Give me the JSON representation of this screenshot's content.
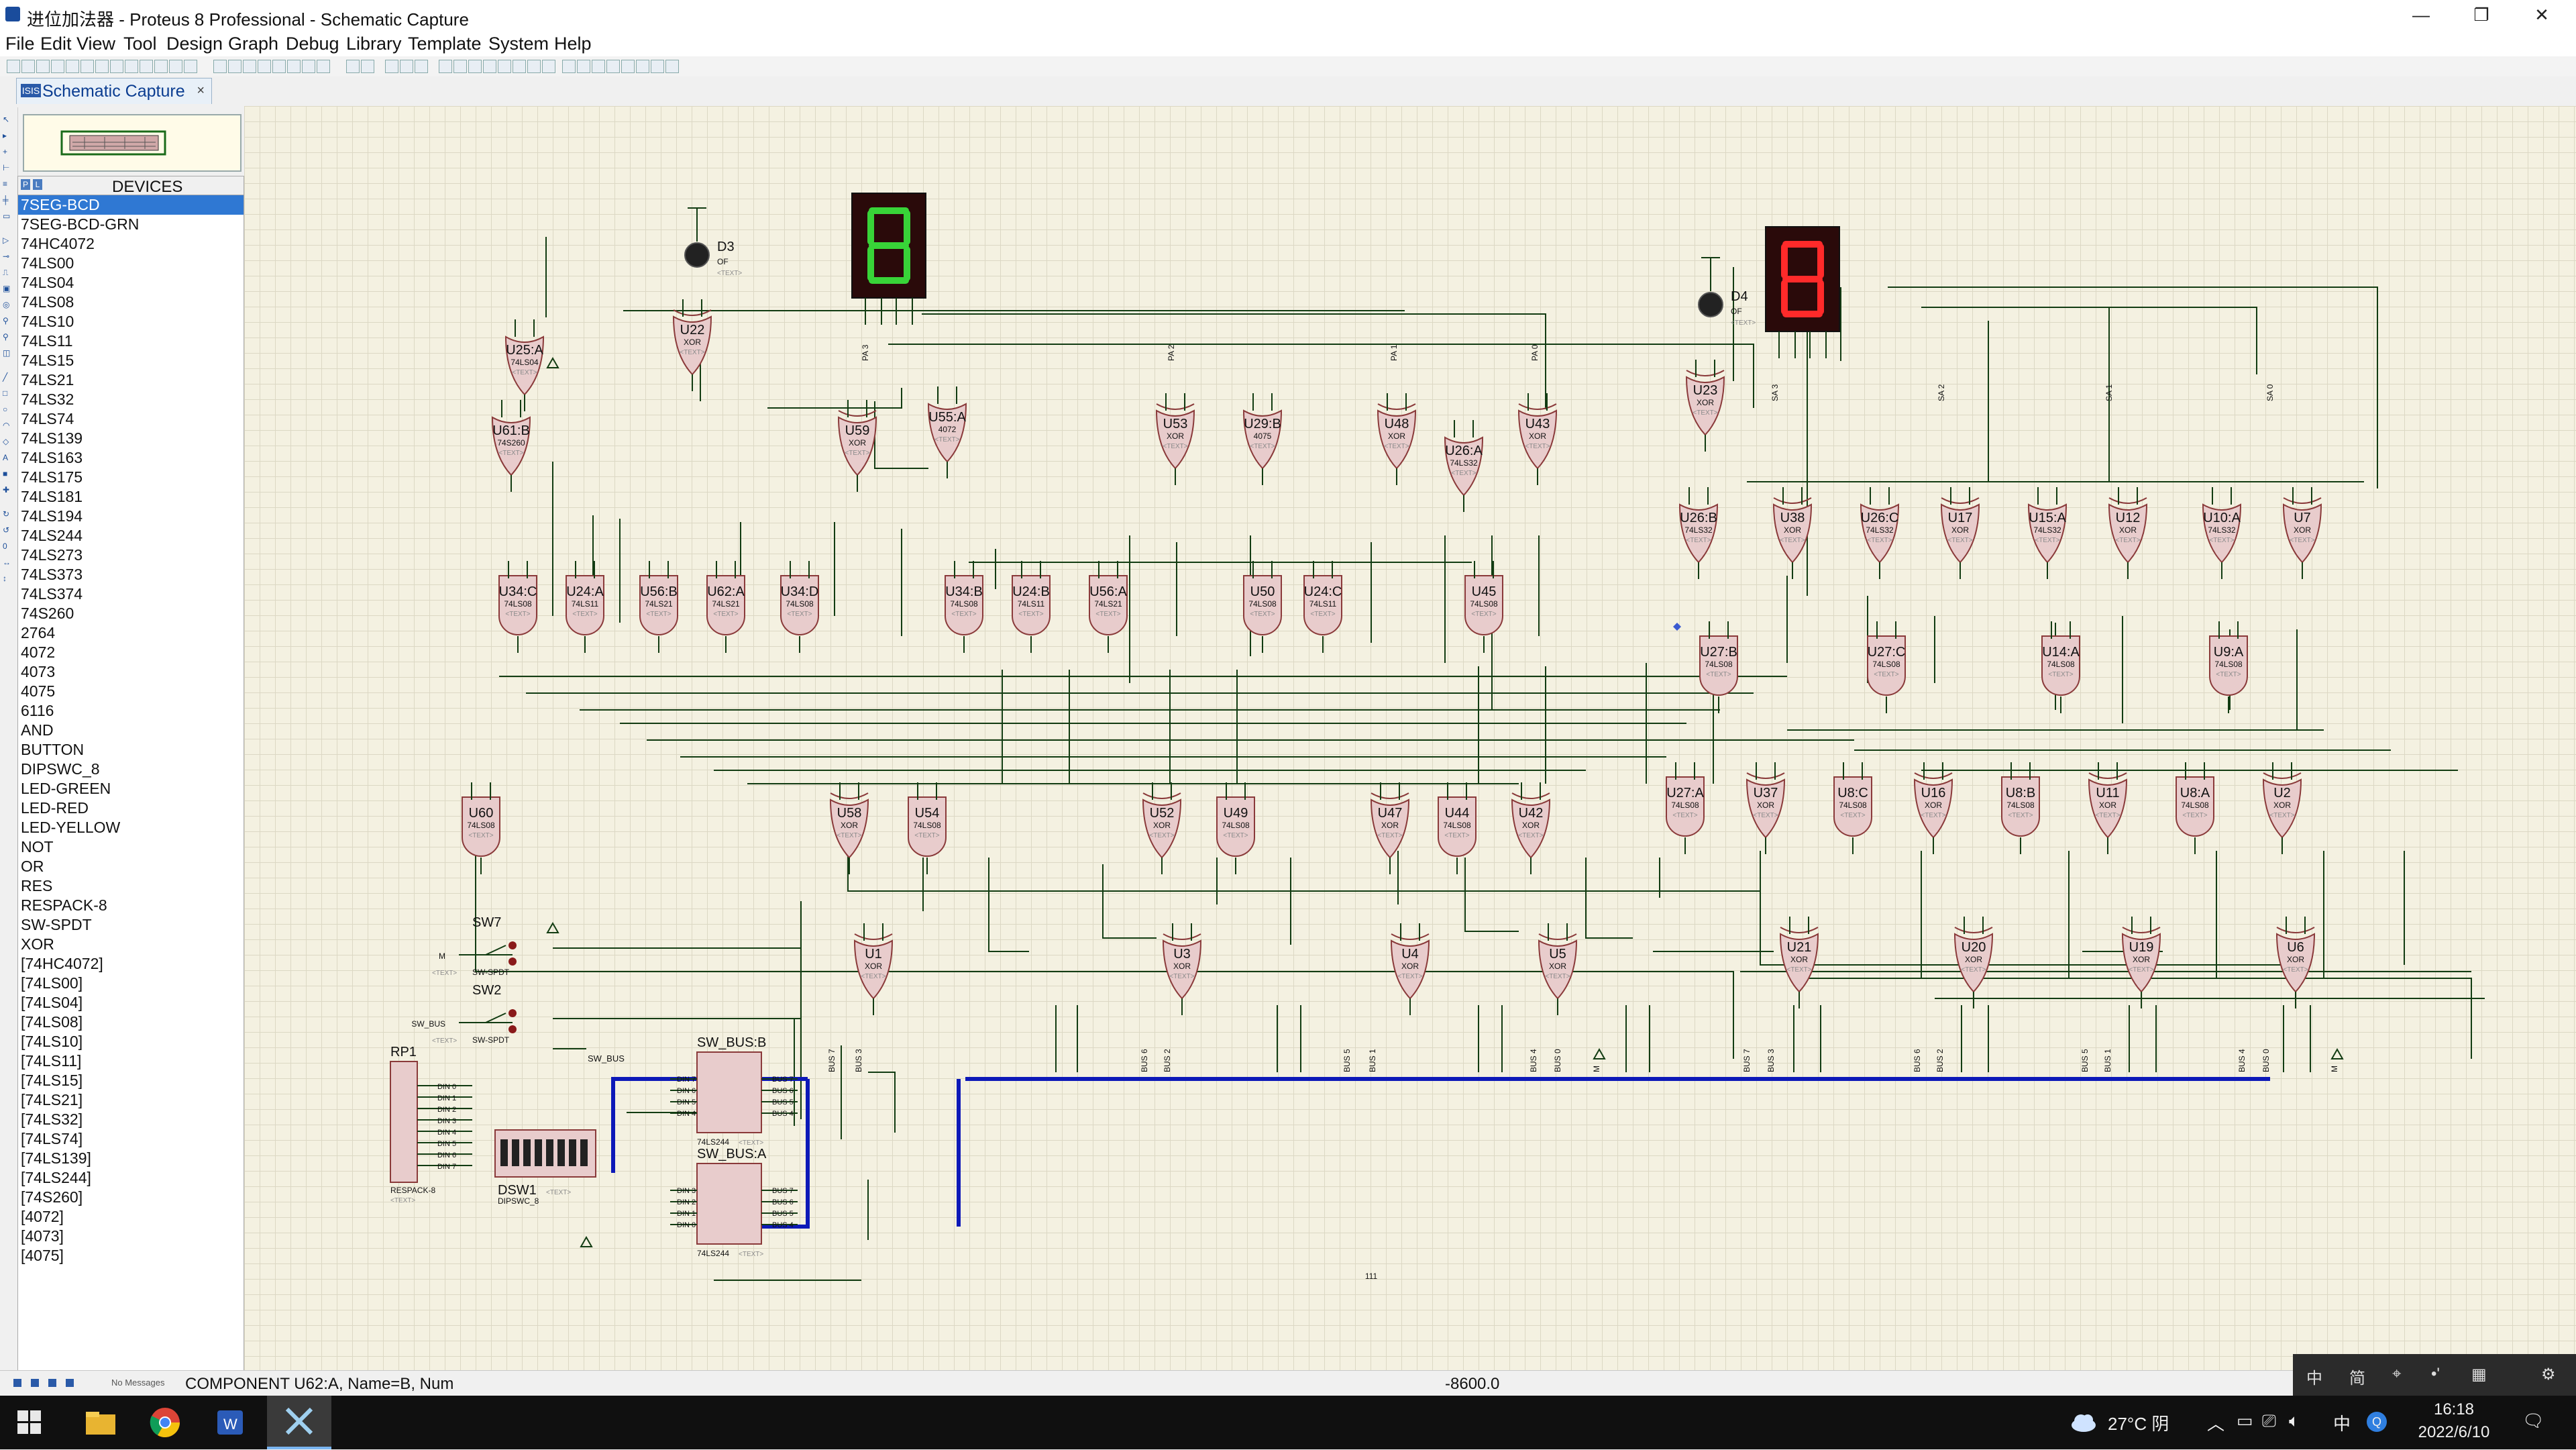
{
  "window": {
    "title": "进位加法器 - Proteus 8 Professional - Schematic Capture",
    "controls": {
      "minimize": "—",
      "restore": "❐",
      "close": "✕"
    }
  },
  "menu": [
    "File",
    "Edit",
    "View",
    "Tool",
    "Design",
    "Graph",
    "Debug",
    "Library",
    "Template",
    "System",
    "Help"
  ],
  "tab": {
    "label": "Schematic Capture",
    "icon_text": "ISIS",
    "close": "×"
  },
  "devices": {
    "header": "DEVICES",
    "pick_button": "P",
    "library_button": "L",
    "selected_index": 0,
    "items": [
      "7SEG-BCD",
      "7SEG-BCD-GRN",
      "74HC4072",
      "74LS00",
      "74LS04",
      "74LS08",
      "74LS10",
      "74LS11",
      "74LS15",
      "74LS21",
      "74LS32",
      "74LS74",
      "74LS139",
      "74LS163",
      "74LS175",
      "74LS181",
      "74LS194",
      "74LS244",
      "74LS273",
      "74LS373",
      "74LS374",
      "74S260",
      "2764",
      "4072",
      "4073",
      "4075",
      "6116",
      "AND",
      "BUTTON",
      "DIPSWC_8",
      "LED-GREEN",
      "LED-RED",
      "LED-YELLOW",
      "NOT",
      "OR",
      "RES",
      "RESPACK-8",
      "SW-SPDT",
      "XOR",
      "[74HC4072]",
      "[74LS00]",
      "[74LS04]",
      "[74LS08]",
      "[74LS10]",
      "[74LS11]",
      "[74LS15]",
      "[74LS21]",
      "[74LS32]",
      "[74LS74]",
      "[74LS139]",
      "[74LS244]",
      "[74S260]",
      "[4072]",
      "[4073]",
      "[4075]"
    ]
  },
  "schematic": {
    "seg_left_color": "#38d438",
    "seg_right_color": "#ff2a2a",
    "bus_color": "#0d19b8",
    "gate_fill": "#e8cccc",
    "gate_stroke": "#8a3a3a",
    "wire_color": "#123c12",
    "probes": [
      {
        "name": "D3",
        "value": "OF"
      },
      {
        "name": "D4",
        "value": "OF"
      }
    ],
    "gates_left": [
      {
        "ref": "U25:A",
        "type": "74LS04"
      },
      {
        "ref": "U22",
        "type": "XOR"
      },
      {
        "ref": "U61:B",
        "type": "74S260"
      },
      {
        "ref": "U59",
        "type": "XOR"
      },
      {
        "ref": "U55:A",
        "type": "4072"
      },
      {
        "ref": "U53",
        "type": "XOR"
      },
      {
        "ref": "U29:B",
        "type": "4075"
      },
      {
        "ref": "U48",
        "type": "XOR"
      },
      {
        "ref": "U26:A",
        "type": "74LS32"
      },
      {
        "ref": "U43",
        "type": "XOR"
      },
      {
        "ref": "U34:C",
        "type": "74LS08"
      },
      {
        "ref": "U24:A",
        "type": "74LS11"
      },
      {
        "ref": "U56:B",
        "type": "74LS21"
      },
      {
        "ref": "U62:A",
        "type": "74LS21"
      },
      {
        "ref": "U34:D",
        "type": "74LS08"
      },
      {
        "ref": "U34:B",
        "type": "74LS08"
      },
      {
        "ref": "U24:B",
        "type": "74LS11"
      },
      {
        "ref": "U56:A",
        "type": "74LS21"
      },
      {
        "ref": "U50",
        "type": "74LS08"
      },
      {
        "ref": "U24:C",
        "type": "74LS11"
      },
      {
        "ref": "U45",
        "type": "74LS08"
      },
      {
        "ref": "U60",
        "type": "74LS08"
      },
      {
        "ref": "U58",
        "type": "XOR"
      },
      {
        "ref": "U54",
        "type": "74LS08"
      },
      {
        "ref": "U52",
        "type": "XOR"
      },
      {
        "ref": "U49",
        "type": "74LS08"
      },
      {
        "ref": "U47",
        "type": "XOR"
      },
      {
        "ref": "U44",
        "type": "74LS08"
      },
      {
        "ref": "U42",
        "type": "XOR"
      },
      {
        "ref": "U1",
        "type": "XOR"
      },
      {
        "ref": "U3",
        "type": "XOR"
      },
      {
        "ref": "U4",
        "type": "XOR"
      },
      {
        "ref": "U5",
        "type": "XOR"
      }
    ],
    "gates_right": [
      {
        "ref": "U23",
        "type": "XOR"
      },
      {
        "ref": "U26:B",
        "type": "74LS32"
      },
      {
        "ref": "U38",
        "type": "XOR"
      },
      {
        "ref": "U26:C",
        "type": "74LS32"
      },
      {
        "ref": "U17",
        "type": "XOR"
      },
      {
        "ref": "U15:A",
        "type": "74LS32"
      },
      {
        "ref": "U12",
        "type": "XOR"
      },
      {
        "ref": "U10:A",
        "type": "74LS32"
      },
      {
        "ref": "U7",
        "type": "XOR"
      },
      {
        "ref": "U27:B",
        "type": "74LS08"
      },
      {
        "ref": "U27:C",
        "type": "74LS08"
      },
      {
        "ref": "U14:A",
        "type": "74LS08"
      },
      {
        "ref": "U9:A",
        "type": "74LS08"
      },
      {
        "ref": "U27:A",
        "type": "74LS08"
      },
      {
        "ref": "U37",
        "type": "XOR"
      },
      {
        "ref": "U8:C",
        "type": "74LS08"
      },
      {
        "ref": "U16",
        "type": "XOR"
      },
      {
        "ref": "U8:B",
        "type": "74LS08"
      },
      {
        "ref": "U11",
        "type": "XOR"
      },
      {
        "ref": "U8:A",
        "type": "74LS08"
      },
      {
        "ref": "U2",
        "type": "XOR"
      },
      {
        "ref": "U21",
        "type": "XOR"
      },
      {
        "ref": "U20",
        "type": "XOR"
      },
      {
        "ref": "U19",
        "type": "XOR"
      },
      {
        "ref": "U6",
        "type": "XOR"
      }
    ],
    "placeholder_text": "<TEXT>",
    "switches": [
      {
        "ref": "SW7",
        "type": "SW-SPDT",
        "net": "M"
      },
      {
        "ref": "SW2",
        "type": "SW-SPDT",
        "net": "SW_BUS"
      }
    ],
    "respack": {
      "ref": "RP1",
      "type": "RESPACK-8"
    },
    "dipswitch": {
      "ref": "DSW1",
      "type": "DIPSWC_8"
    },
    "buffers": [
      {
        "ref": "SW_BUS:B",
        "type": "74LS244"
      },
      {
        "ref": "SW_BUS:A",
        "type": "74LS244"
      }
    ],
    "bus_labels_left": [
      "BUS 7",
      "BUS 3",
      "BUS 6",
      "BUS 2",
      "BUS 5",
      "BUS 1",
      "BUS 4",
      "BUS 0",
      "M"
    ],
    "bus_labels_right": [
      "BUS 7",
      "BUS 3",
      "BUS 6",
      "BUS 2",
      "BUS 5",
      "BUS 1",
      "BUS 4",
      "BUS 0",
      "M"
    ],
    "segment_net_labels_left": [
      "PA 3",
      "PA 2",
      "PA 1",
      "PA 0"
    ],
    "segment_net_labels_right": [
      "SA 3",
      "SA 2",
      "SA 1",
      "SA 0"
    ],
    "din_labels": [
      "DIN 0",
      "DIN 1",
      "DIN 2",
      "DIN 3",
      "DIN 4",
      "DIN 5",
      "DIN 6",
      "DIN 7"
    ],
    "sw_bus_label": "SW_BUS",
    "page_number": "111"
  },
  "status": {
    "message": "No Messages",
    "component": "COMPONENT U62:A, Name=B, Num",
    "coordinate": "-8600.0"
  },
  "taskbar": {
    "weather": "27°C 阴",
    "ime": "中",
    "time": "16:18",
    "date": "2022/6/10"
  },
  "ime_bar": [
    "中",
    "简",
    "⌖",
    "•'",
    "▦",
    "⚙"
  ]
}
